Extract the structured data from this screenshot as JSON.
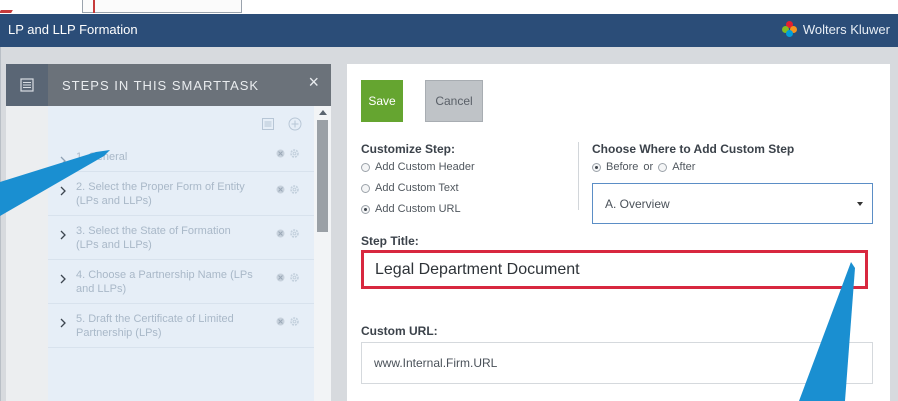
{
  "header": {
    "title": "LP and LLP Formation",
    "brand": "Wolters Kluwer"
  },
  "steps_panel": {
    "title": "STEPS IN THIS SMARTTASK",
    "close_glyph": "×",
    "items": [
      {
        "label": "1. General"
      },
      {
        "label": "2. Select the Proper Form of Entity (LPs and LLPs)"
      },
      {
        "label": "3. Select the State of Formation (LPs and LLPs)"
      },
      {
        "label": "4. Choose a Partnership Name (LPs and LLPs)"
      },
      {
        "label": "5. Draft the Certificate of Limited Partnership (LPs)"
      }
    ]
  },
  "form": {
    "save_label": "Save",
    "cancel_label": "Cancel",
    "customize_step_label": "Customize Step:",
    "customize_options": [
      {
        "label": "Add Custom Header",
        "checked": false
      },
      {
        "label": "Add Custom Text",
        "checked": false
      },
      {
        "label": "Add Custom URL",
        "checked": true
      }
    ],
    "where_label": "Choose Where to Add Custom Step",
    "before_label": "Before",
    "or_label": "or",
    "after_label": "After",
    "position_selected": "before",
    "step_select_value": "A. Overview",
    "step_title_label": "Step Title:",
    "step_title_value": "Legal Department Document",
    "custom_url_label": "Custom URL:",
    "custom_url_value": "www.Internal.Firm.URL"
  },
  "colors": {
    "header_bg": "#2b4d78",
    "save_green": "#65a530",
    "highlight_red": "#d8283f",
    "callout_blue": "#1a8fd1"
  }
}
